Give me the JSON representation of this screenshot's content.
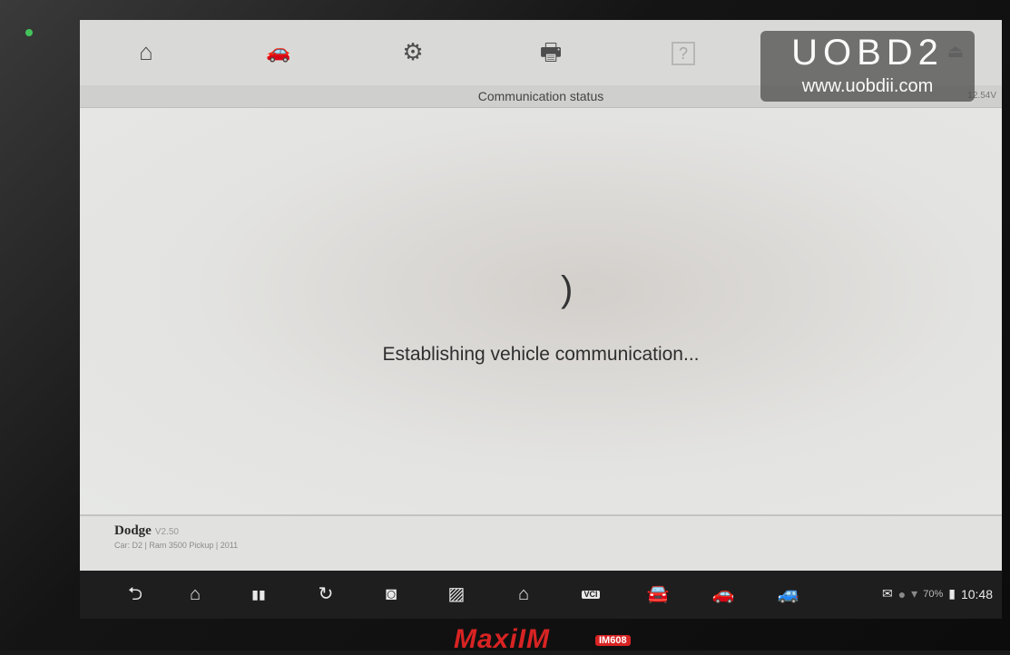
{
  "toolbar": {
    "icons": [
      "home-icon",
      "vehicle-icon",
      "settings-icon",
      "print-icon",
      "help-icon",
      "exit-icon"
    ],
    "home_glyph": "⌂",
    "vehicle_glyph": "🚗",
    "settings_glyph": "⚙",
    "print_glyph": "🖶",
    "help_glyph": "?",
    "exit_glyph": "⏏"
  },
  "status": {
    "title": "Communication status",
    "voltage": "12.54V"
  },
  "watermark": {
    "brand": "UOBD2",
    "url": "www.uobdii.com"
  },
  "main": {
    "spinner_glyph": ")",
    "message": "Establishing vehicle communication..."
  },
  "vehicle": {
    "make": "Dodge",
    "version": "V2.50",
    "car": "Car: D2 | Ram 3500 Pickup | 2011"
  },
  "navbar": {
    "back": "⮌",
    "home": "⌂",
    "recent": "▮▮",
    "refresh": "↻",
    "camera": "◙",
    "screenshot": "▨",
    "maxi_home": "⌂",
    "vci_badge": "VCI",
    "vci_glyph": "▭",
    "car_connected": "🚘",
    "car": "🚗",
    "shop": "🚙"
  },
  "tray": {
    "msg": "✉",
    "status_dot": "●",
    "wifi": "▾",
    "battery_percent": "70%",
    "battery_glyph": "▮",
    "time": "10:48"
  },
  "device": {
    "brand": "MaxiIM",
    "model": "IM608"
  }
}
